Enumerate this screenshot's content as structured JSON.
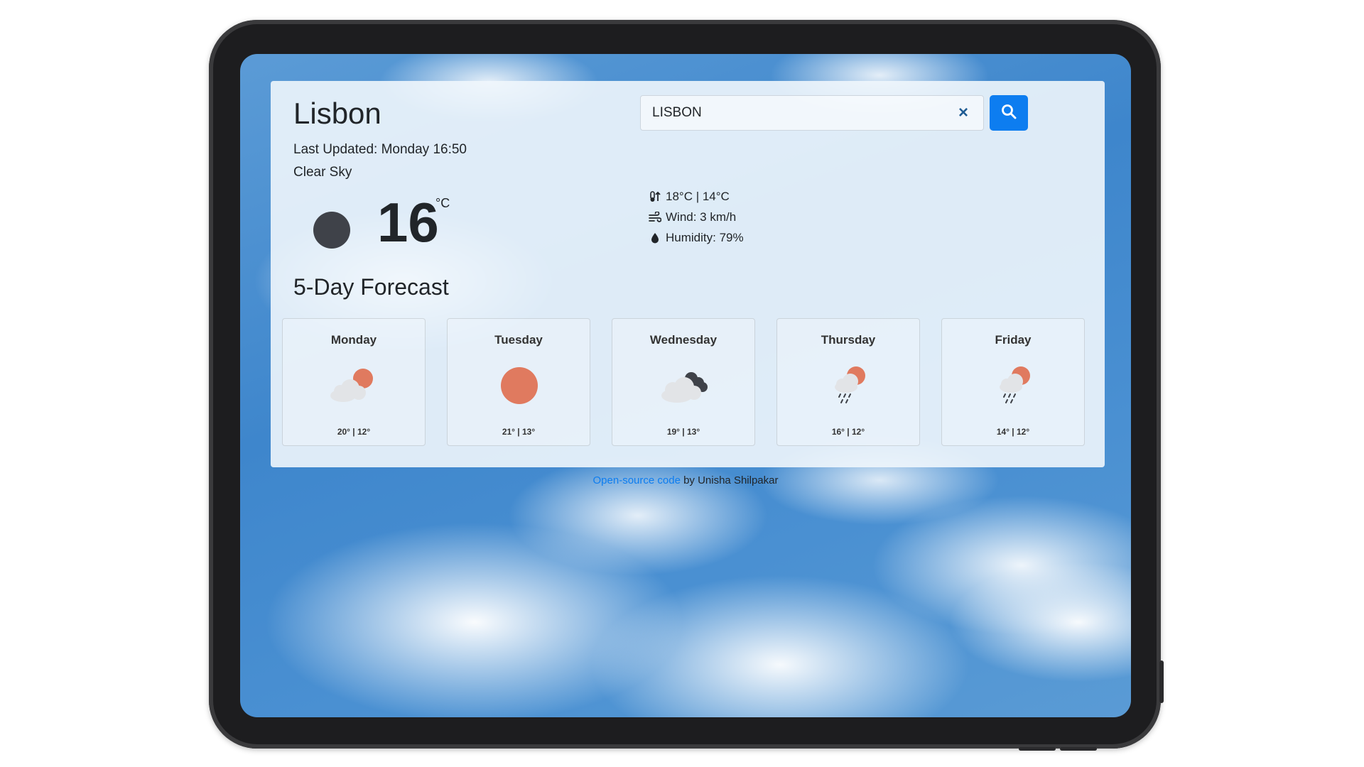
{
  "weather": {
    "city": "Lisbon",
    "last_updated": "Last Updated: Monday 16:50",
    "description": "Clear Sky",
    "temperature": "16",
    "unit": "°C",
    "current_icon": "moon-icon",
    "high_low": "18°C | 14°C",
    "wind": "Wind: 3 km/h",
    "humidity": "Humidity: 79%"
  },
  "search": {
    "value": "LISBON",
    "clear_label": "×"
  },
  "forecast": {
    "title": "5-Day Forecast",
    "days": [
      {
        "day": "Monday",
        "temps": "20° | 12°",
        "icon": "partly-cloudy-icon"
      },
      {
        "day": "Tuesday",
        "temps": "21° | 13°",
        "icon": "sunny-icon"
      },
      {
        "day": "Wednesday",
        "temps": "19° | 13°",
        "icon": "cloudy-icon"
      },
      {
        "day": "Thursday",
        "temps": "16° | 12°",
        "icon": "rain-icon"
      },
      {
        "day": "Friday",
        "temps": "14° | 12°",
        "icon": "rain-icon"
      }
    ]
  },
  "footer": {
    "link_text": "Open-source code",
    "author_text": " by Unisha Shilpakar"
  },
  "colors": {
    "accent": "#0d7df0",
    "sun": "#e07a5f",
    "moon": "#3f4249"
  }
}
